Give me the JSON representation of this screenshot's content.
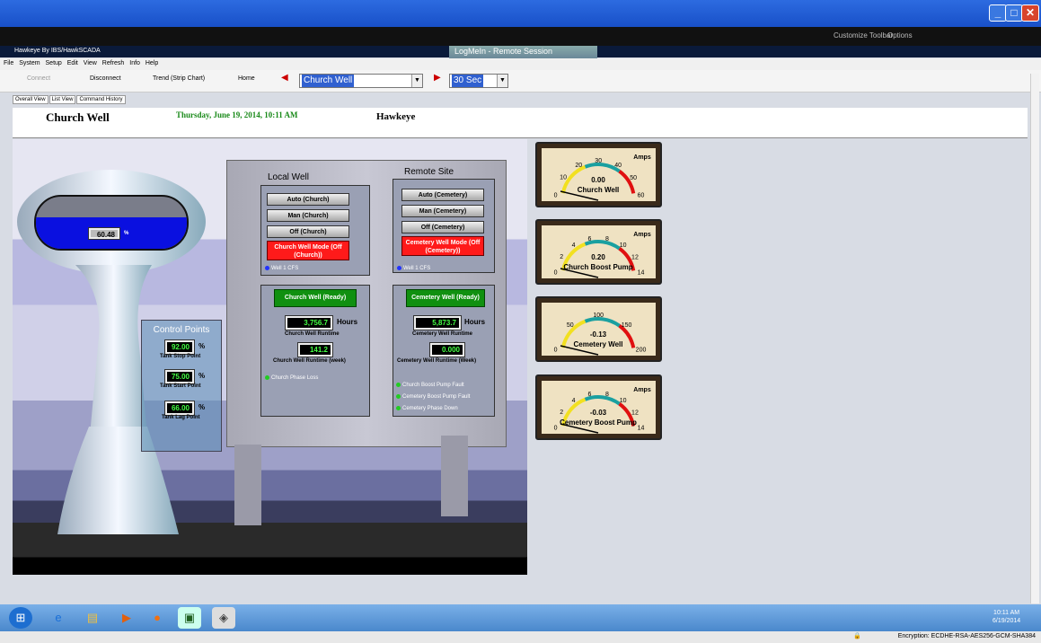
{
  "outer": {
    "toolbar_customize": "Customize Toolbar",
    "toolbar_options": "Options",
    "session_tab": "LogMeIn - Remote Session"
  },
  "app": {
    "title": "Hawkeye By IBS/HawkSCADA",
    "menu": [
      "File",
      "System Setup",
      "Edit",
      "View",
      "Refresh",
      "Info",
      "Help"
    ]
  },
  "toolbar": {
    "connect": "Connect",
    "disconnect": "Disconnect",
    "trend": "Trend (Strip Chart)",
    "home": "Home",
    "site": "Church Well",
    "interval": "30 Sec"
  },
  "tabs": [
    "Overall View",
    "List View",
    "Command History"
  ],
  "header": {
    "site": "Church Well",
    "date": "Thursday, June 19, 2014, 10:11 AM",
    "brand": "Hawkeye"
  },
  "tank": {
    "level": "60.48",
    "unit": "%",
    "level_fraction": 0.6048
  },
  "control_points": {
    "title": "Control Points",
    "items": [
      {
        "value": "92.00",
        "unit": "%",
        "label": "Tank Stop Point"
      },
      {
        "value": "75.00",
        "unit": "%",
        "label": "Tank Start Point"
      },
      {
        "value": "66.00",
        "unit": "%",
        "label": "Tank Lag Point"
      }
    ]
  },
  "local": {
    "title": "Local Well",
    "buttons": [
      "Auto (Church)",
      "Man (Church)",
      "Off (Church)"
    ],
    "mode": "Church Well Mode (Off (Church))",
    "cfs": "Well 1 CFS",
    "status": "Church Well (Ready)",
    "runtime": "3,756.7",
    "hours": "Hours",
    "runtime_label": "Church Well Runtime",
    "week": "141.2",
    "week_label": "Church Well Runtime (week)",
    "phase": "Church Phase Loss"
  },
  "remote": {
    "title": "Remote Site",
    "buttons": [
      "Auto (Cemetery)",
      "Man (Cemetery)",
      "Off (Cemetery)"
    ],
    "mode": "Cemetery Well Mode (Off (Cemetery))",
    "cfs": "Well 1 CFS",
    "status": "Cemetery Well (Ready)",
    "runtime": "5,873.7",
    "hours": "Hours",
    "runtime_label": "Cemetery Well Runtime",
    "week": "0.000",
    "week_label": "Cemetery Well Runtime (Week)",
    "faults": [
      "Church Boost Pump Fault",
      "Cemetery Boost Pump Fault",
      "Cemetery Phase Down"
    ]
  },
  "gauges": [
    {
      "name": "Church Well",
      "value": "0.00",
      "unit": "Amps",
      "ticks": [
        "0",
        "10",
        "20",
        "30",
        "40",
        "50",
        "60"
      ]
    },
    {
      "name": "Church Boost Pump",
      "value": "0.20",
      "unit": "Amps",
      "ticks": [
        "0",
        "2",
        "4",
        "6",
        "8",
        "10",
        "12",
        "14"
      ]
    },
    {
      "name": "Cemetery Well",
      "value": "-0.13",
      "unit": "",
      "ticks": [
        "0",
        "50",
        "100",
        "150",
        "200"
      ]
    },
    {
      "name": "Cemetery Boost Pump",
      "value": "-0.03",
      "unit": "Amps",
      "ticks": [
        "0",
        "2",
        "4",
        "6",
        "8",
        "10",
        "12",
        "14"
      ]
    }
  ],
  "taskbar": {
    "time": "10:11 AM",
    "date": "6/19/2014"
  },
  "status": {
    "encryption": "Encryption: ECDHE-RSA-AES256-GCM-SHA384"
  }
}
